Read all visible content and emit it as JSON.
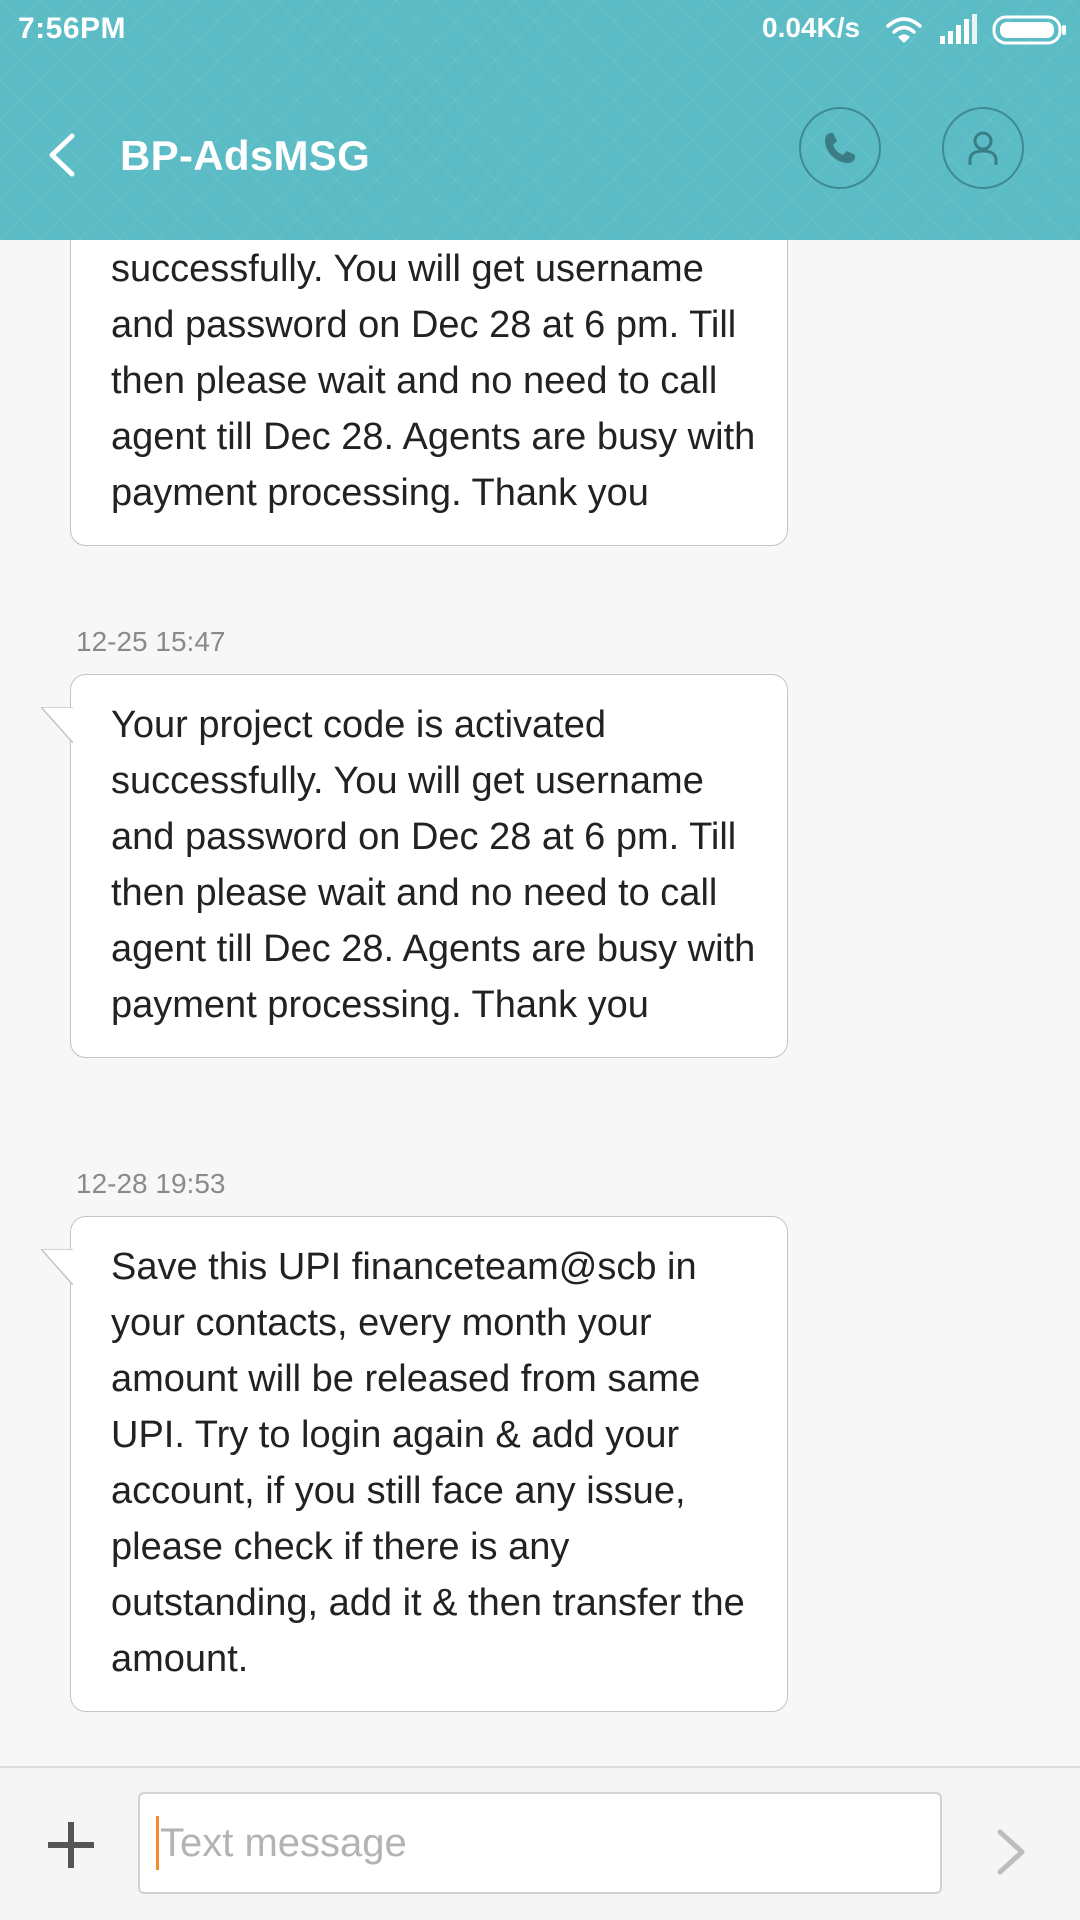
{
  "status_bar": {
    "time": "7:56PM",
    "network_speed": "0.04K/s",
    "icons": [
      "wifi-icon",
      "signal-icon",
      "battery-icon"
    ]
  },
  "header": {
    "title": "BP-AdsMSG",
    "back_icon": "chevron-left-icon",
    "call_icon": "phone-icon",
    "contact_icon": "person-icon",
    "accent_color": "#5bbcc6"
  },
  "messages": [
    {
      "timestamp": "",
      "text": "Your project code is activated successfully. You will get username and password on Dec 28 at 6 pm. Till then please wait and no need to call agent till Dec 28. Agents are busy with payment processing. Thank you"
    },
    {
      "timestamp": "12-25 15:47",
      "text": "Your project code is activated successfully. You will get username and password on Dec 28 at 6 pm. Till then please wait and no need to call agent till Dec 28. Agents are busy with payment processing. Thank you"
    },
    {
      "timestamp": "12-28 19:53",
      "text": "Save this UPI financeteam@scb in your contacts, every month your amount will be released from same UPI. Try to login again & add your account, if you still face any issue, please check if there is any outstanding, add it & then transfer the amount."
    }
  ],
  "composer": {
    "placeholder": "Text message",
    "value": "",
    "add_icon": "plus-icon",
    "send_icon": "send-chevron-icon",
    "caret_color": "#f28c28"
  }
}
